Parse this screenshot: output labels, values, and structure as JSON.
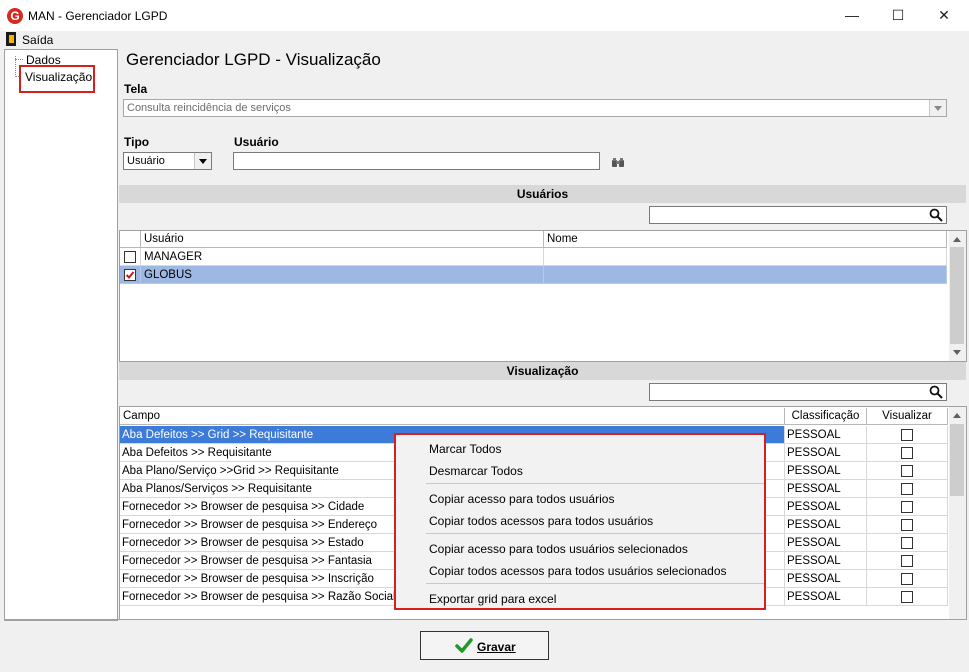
{
  "window": {
    "title": "MAN - Gerenciador LGPD",
    "app_icon_letter": "G",
    "minimize_glyph": "—",
    "maximize_glyph": "☐",
    "close_glyph": "✕"
  },
  "menu": {
    "exit_label": "Saída",
    "exit_icon": "exit-door-icon"
  },
  "tree": {
    "items": [
      "Dados",
      "Visualização"
    ],
    "selected": "Visualização"
  },
  "page": {
    "title": "Gerenciador LGPD - Visualização"
  },
  "form": {
    "tela_label": "Tela",
    "tela_value": "Consulta reincidência de serviços",
    "tipo_label": "Tipo",
    "tipo_value": "Usuário",
    "usuario_label": "Usuário",
    "usuario_value": "",
    "binoculars_icon": "binoculars-icon"
  },
  "users_section": {
    "title": "Usuários",
    "search_value": "",
    "columns": [
      "Usuário",
      "Nome"
    ],
    "rows": [
      {
        "checked": false,
        "usuario": "MANAGER",
        "nome": "",
        "selected": false
      },
      {
        "checked": true,
        "usuario": "GLOBUS",
        "nome": "",
        "selected": true
      }
    ]
  },
  "view_section": {
    "title": "Visualização",
    "search_value": "",
    "columns": [
      "Campo",
      "Classificação",
      "Visualizar"
    ],
    "rows": [
      {
        "campo": "Aba Defeitos >> Grid >> Requisitante",
        "classificacao": "PESSOAL",
        "visualizar": false,
        "selected": true
      },
      {
        "campo": "Aba Defeitos >> Requisitante",
        "classificacao": "PESSOAL",
        "visualizar": false,
        "selected": false
      },
      {
        "campo": "Aba Plano/Serviço >>Grid >> Requisitante",
        "classificacao": "PESSOAL",
        "visualizar": false,
        "selected": false
      },
      {
        "campo": "Aba Planos/Serviços >> Requisitante",
        "classificacao": "PESSOAL",
        "visualizar": false,
        "selected": false
      },
      {
        "campo": "Fornecedor >> Browser de pesquisa >> Cidade",
        "classificacao": "PESSOAL",
        "visualizar": false,
        "selected": false
      },
      {
        "campo": "Fornecedor >> Browser de pesquisa >> Endereço",
        "classificacao": "PESSOAL",
        "visualizar": false,
        "selected": false
      },
      {
        "campo": "Fornecedor >> Browser de pesquisa >> Estado",
        "classificacao": "PESSOAL",
        "visualizar": false,
        "selected": false
      },
      {
        "campo": "Fornecedor >> Browser de pesquisa >> Fantasia",
        "classificacao": "PESSOAL",
        "visualizar": false,
        "selected": false
      },
      {
        "campo": "Fornecedor >> Browser de pesquisa >> Inscrição",
        "classificacao": "PESSOAL",
        "visualizar": false,
        "selected": false
      },
      {
        "campo": "Fornecedor >> Browser de pesquisa >> Razão Social",
        "classificacao": "PESSOAL",
        "visualizar": false,
        "selected": false
      }
    ]
  },
  "context_menu": {
    "groups": [
      [
        "Marcar Todos",
        "Desmarcar Todos"
      ],
      [
        "Copiar acesso para todos usuários",
        "Copiar todos acessos para todos usuários"
      ],
      [
        "Copiar acesso para todos usuários selecionados",
        "Copiar todos acessos para todos usuários selecionados"
      ],
      [
        "Exportar grid para excel"
      ]
    ]
  },
  "footer": {
    "save_label": "Gravar",
    "save_icon": "checkmark-icon"
  },
  "colors": {
    "selection": "#3d7bd9",
    "row_selected": "#9eb8e4",
    "highlight_border": "#d62020"
  }
}
